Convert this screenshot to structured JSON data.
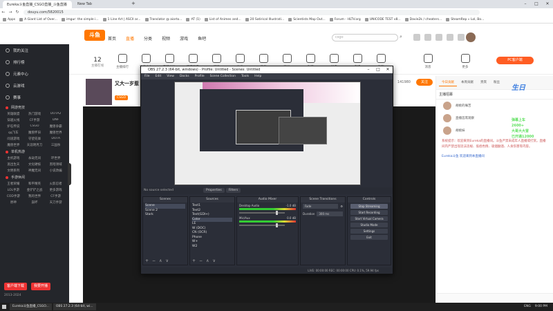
{
  "browser": {
    "tabs": [
      {
        "title": "Eureka斗鱼直播_CSGO直播_斗鱼直播",
        "active": true
      },
      {
        "title": "New Tab",
        "active": false
      }
    ],
    "url": "douyu.com/5820015",
    "bookmarks": [
      "Apps",
      "A Giant List of Over...",
      "imgur: the simple i...",
      "1 Line Art | ASCII ar...",
      "Translator @ aiorto...",
      "AT (1)",
      "List of Animes and...",
      "20 Satirical Illustrati...",
      "Scientists Map Out...",
      "Forum - HLTV.org",
      "UNICODE TEST v8...",
      "Davie2k / cheaters...",
      "SteamRep » Lol, Bo..."
    ]
  },
  "douyu": {
    "logo": "斗鱼",
    "nav": [
      "首页",
      "直播",
      "分类",
      "视频",
      "游戏",
      "鱼吧"
    ],
    "active_nav": "直播",
    "search_placeholder": "csgo",
    "follow_count": "12",
    "follow_label": "主播在线",
    "pc_button": "PC客户端",
    "categories": [
      "主播排行",
      "消息中心",
      "我的关注",
      "观看历史",
      "订阅",
      "分类",
      "任务",
      "粉丝",
      "鱼吧",
      "创作",
      "直播",
      "投稿",
      "消息",
      "更多"
    ]
  },
  "sidebar": {
    "items": [
      "我的关注",
      "排行榜",
      "元素中心",
      "云游戏",
      "赛事"
    ],
    "sections": [
      {
        "title": "网游竞技",
        "games": [
          "英雄联盟",
          "热门游戏",
          "DOTA2",
          "穿越火线",
          "CF手游",
          "DNF",
          "炉石传说",
          "CSGO",
          "魔兽争霸",
          "qq飞车",
          "魔兽怀旧",
          "魔兽世界",
          "问道游戏",
          "守望先锋",
          "DOTA",
          "魔兽世界",
          "天涯明月刀",
          "三国杀"
        ]
      },
      {
        "title": "单机热游",
        "games": [
          "主机游戏",
          "永劫无间",
          "环世界",
          "逃出生天",
          "文化硬核",
          "黑暗领域",
          "文明系列",
          "神魔无间",
          "小说改编"
        ]
      },
      {
        "title": "手游休闲",
        "games": [
          "王者荣耀",
          "和平精英",
          "火影忍者",
          "LOL手游",
          "金铲铲之战",
          "更多游戏",
          "COD手游",
          "我的世界",
          "CF手游",
          "原神",
          "崩坏",
          "天刀手游"
        ]
      }
    ],
    "bottom_buttons": [
      "客户端下载",
      "我要开播"
    ],
    "footer": "2013-2024"
  },
  "streamer": {
    "title": "又大一岁惹",
    "name": "Eureka斗鱼",
    "tag": "CSGO",
    "hot": "141980",
    "follow_btn": "关注"
  },
  "rightpanel": {
    "tabs": [
      "今日贡献",
      "本周贡献",
      "贵宾",
      "粉丝"
    ],
    "sub": "主播招募",
    "ranks": [
      {
        "name": "胡桃的痛苦"
      },
      {
        "name": "直播首席观察"
      },
      {
        "name": "胡桃妹"
      }
    ],
    "system_msg": "系统提示：欢迎来到Eureka的直播间。斗鱼严禁未成年人直播或打赏。直播间内严禁出现违法违规、低俗色情、吸烟酗酒、人身伤害等内容。",
    "chat_line": "Eureka斗鱼 欢迎来到本直播间",
    "big_badge": "生日",
    "overlay": [
      "弹幕上车",
      "2600+",
      "大哥大大冒",
      "已开通12000"
    ]
  },
  "obs": {
    "title": "OBS 27.2.3 (64-bit, windows) - Profile: Untitled - Scenes: Untitled",
    "menu": [
      "File",
      "Edit",
      "View",
      "Docks",
      "Profile",
      "Scene Collection",
      "Tools",
      "Help"
    ],
    "no_source": "No source selected",
    "props_btn": "Properties",
    "filters_btn": "Filters",
    "scenes_header": "Scenes",
    "scenes": [
      "Scene",
      "Scene 2",
      "Stark"
    ],
    "sources_header": "Sources",
    "sources": [
      "Text1",
      "Text2",
      "Text(GDI+)",
      "Color",
      "LE",
      "W (DOC)",
      "CN (OCR)",
      "Phone",
      "W+",
      "W2"
    ],
    "mixer_header": "Audio Mixer",
    "mixer": [
      {
        "name": "Desktop Audio",
        "db": "-1.0 dB"
      },
      {
        "name": "Mic/Aux",
        "db": "0.0 dB"
      }
    ],
    "transitions_header": "Scene Transitions",
    "transition": "Fade",
    "duration_label": "Duration",
    "duration": "300 ms",
    "controls_header": "Controls",
    "controls": [
      "Stop Streaming",
      "Start Recording",
      "Start Virtual Camera",
      "Studio Mode",
      "Settings",
      "Exit"
    ],
    "status": "LIVE: 00:00:00    REC: 00:00:00    CPU: 0.1%, 59.94 fps"
  },
  "taskbar": {
    "tasks": [
      "Eureka斗鱼直播_CSGO...",
      "OBS 27.2.3 (64-bit, wi..."
    ],
    "tray": [
      "ENG",
      "9:00 PM"
    ]
  }
}
